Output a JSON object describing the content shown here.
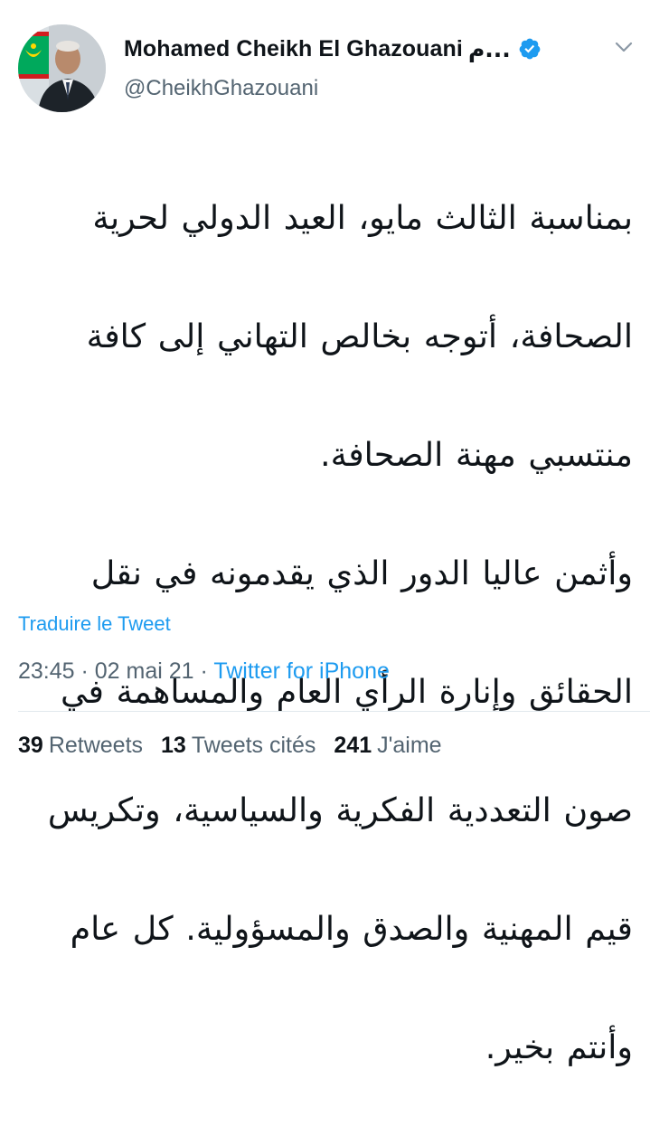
{
  "author": {
    "display_name": "Mohamed Cheikh El Ghazouani",
    "name_suffix": "م...",
    "handle": "@CheikhGhazouani",
    "verified": true
  },
  "tweet": {
    "lines": [
      "بمناسبة الثالث مايو، العيد الدولي لحرية",
      "الصحافة، أتوجه بخالص التهاني إلى كافة",
      "منتسبي مهنة الصحافة.",
      "وأثمن عاليا الدور الذي يقدمونه في نقل",
      "الحقائق وإنارة الرأي العام والمساهمة في",
      "صون التعددية الفكرية والسياسية، وتكريس",
      "قيم المهنية والصدق والمسؤولية. كل عام",
      "وأنتم بخير."
    ],
    "translate_label": "Traduire le Tweet",
    "time": "23:45",
    "separator1": " · ",
    "date": "02 mai 21",
    "separator2": " · ",
    "source": "Twitter for iPhone"
  },
  "stats": {
    "retweets_count": "39",
    "retweets_label": "Retweets",
    "quotes_count": "13",
    "quotes_label": "Tweets cités",
    "likes_count": "241",
    "likes_label": "J'aime"
  },
  "colors": {
    "accent": "#1d9bf0",
    "secondary_text": "#536471",
    "primary_text": "#0f1419",
    "divider": "#e1e8ed"
  },
  "icons": {
    "verified": "verified-badge-icon",
    "chevron": "chevron-down-icon"
  }
}
